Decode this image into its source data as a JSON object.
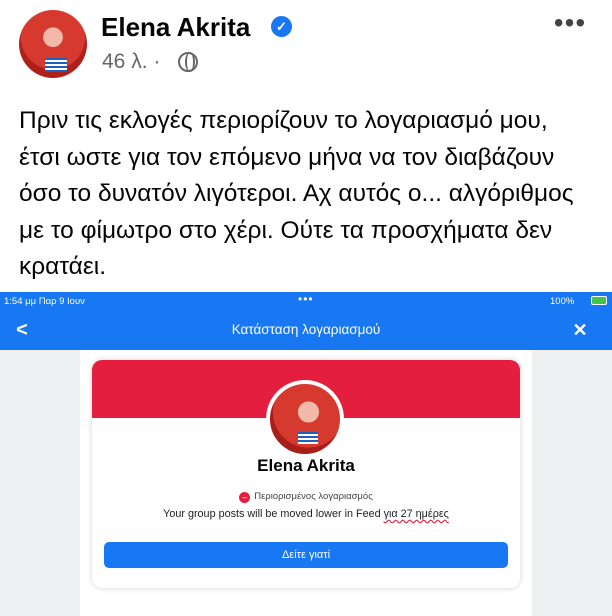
{
  "post": {
    "author": "Elena Akrita",
    "meta": "46 λ. ·",
    "text": "Πριν τις εκλογές περιορίζουν το λογαριασμό μου, έτσι ωστε για τον επόμενο μήνα να τον διαβάζουν όσο το δυνατόν λιγότεροι. Αχ αυτός ο... αλγόριθμος με το φίμωτρο στο χέρι. Ούτε τα προσχήματα δεν κρατάει.",
    "more_label": "•••"
  },
  "embed": {
    "status": {
      "time": "1:54 μμ  Παρ 9 Ιουν",
      "dots": "•••",
      "battery": "100%"
    },
    "nav": {
      "back": "<",
      "title": "Κατάσταση λογαριασμού",
      "close": "✕"
    },
    "card": {
      "name": "Elena Akrita",
      "restricted_label": "Περιορισμένος λογαριασμός",
      "restricted_icon": "–",
      "moved_text_prefix": "Your group posts will be moved lower in Feed ",
      "moved_text_days": "για 27 ημέρες",
      "button_label": "Δείτε γιατί"
    }
  },
  "colors": {
    "facebook_blue": "#1877f2",
    "restricted_red": "#e41e3f"
  }
}
